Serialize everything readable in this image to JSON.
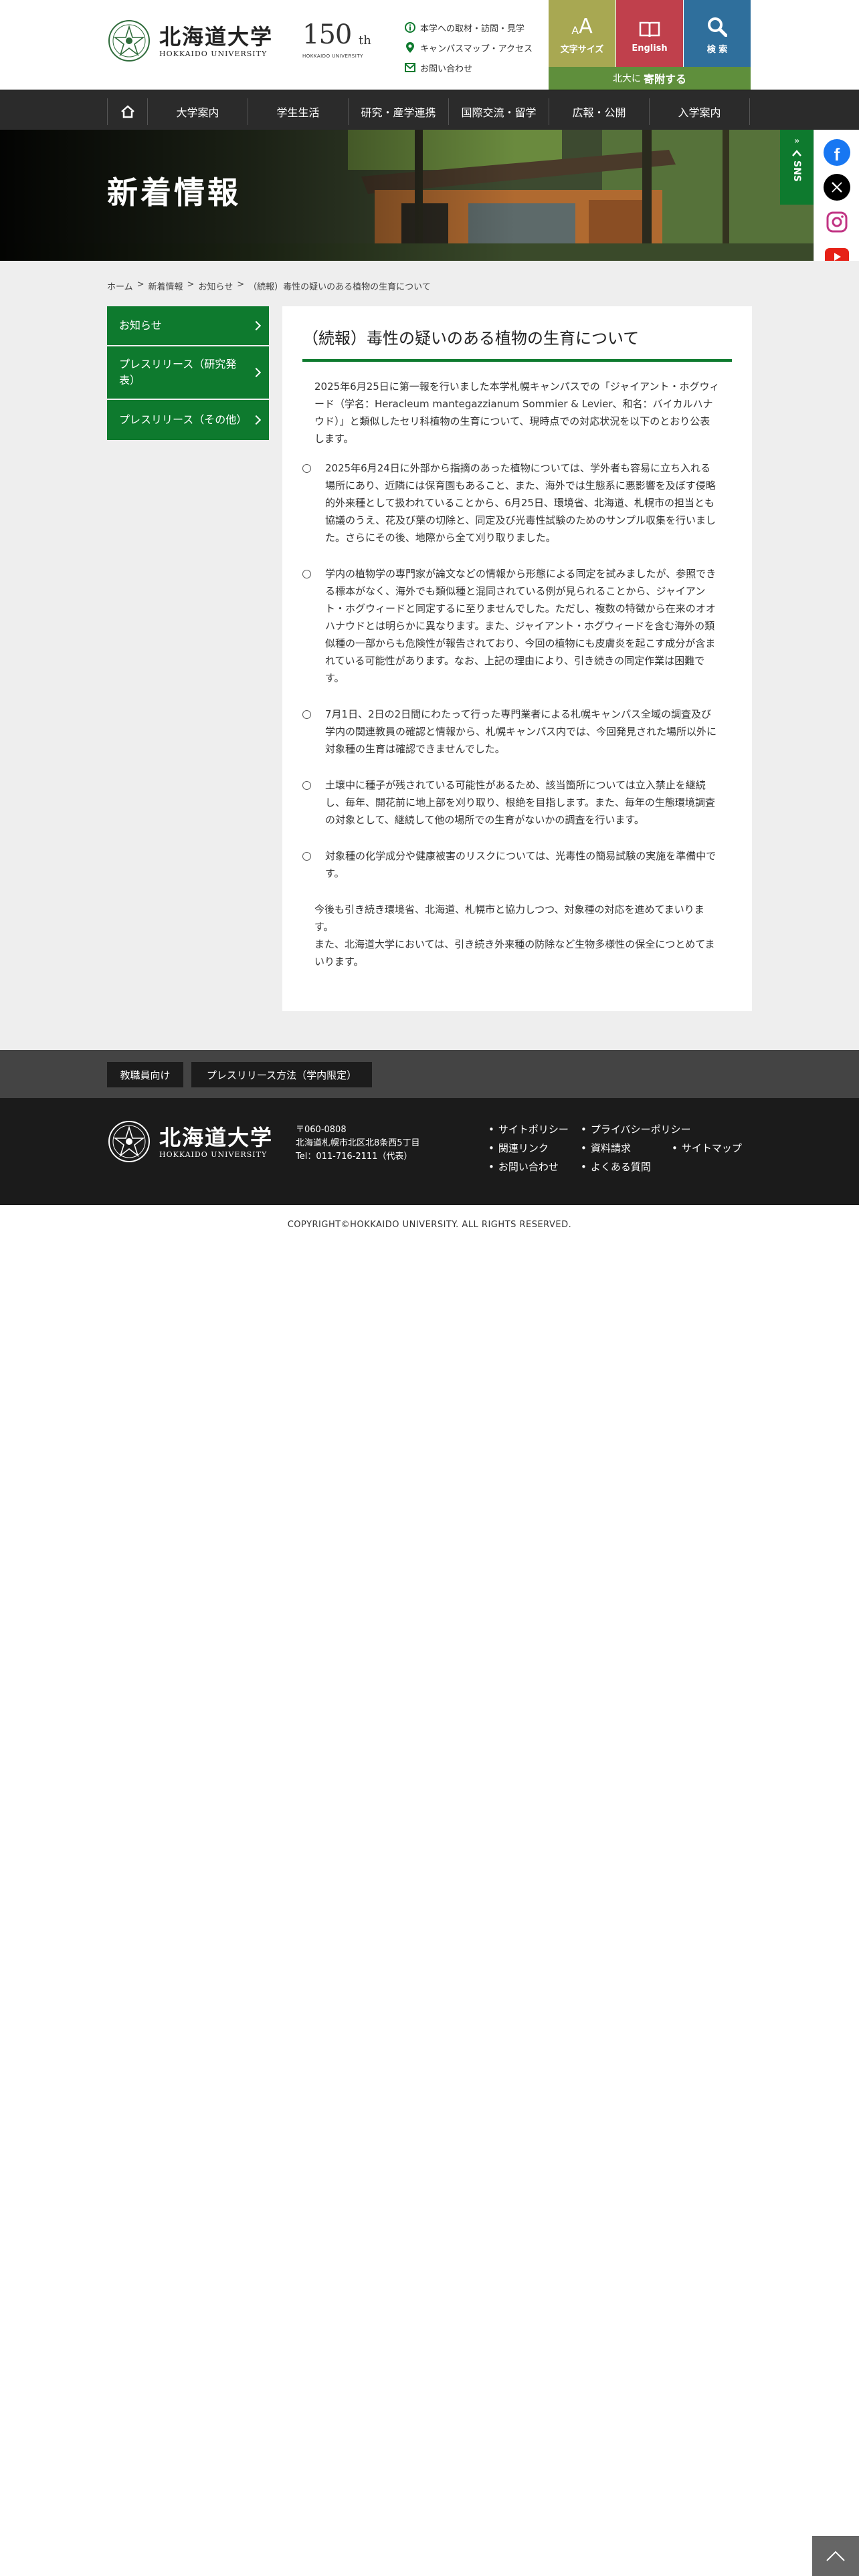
{
  "header": {
    "logo_ja": "北海道大学",
    "logo_en": "HOKKAIDO UNIVERSITY",
    "anniv_number": "150",
    "anniv_suffix": "th",
    "anniv_caption": "HOKKAIDO UNIVERSITY",
    "links": [
      {
        "label": "本学への取材・訪問・見学",
        "icon": "info-circle-icon"
      },
      {
        "label": "キャンパスマップ・アクセス",
        "icon": "map-pin-icon"
      },
      {
        "label": "お問い合わせ",
        "icon": "mail-icon"
      }
    ],
    "font_size_label": "文字サイズ",
    "english_label": "English",
    "search_label": "検 索",
    "donate_prefix": "北大に",
    "donate_strong": "寄附する",
    "colors": {
      "font_size": "#a8a852",
      "english": "#c0404c",
      "search": "#2f6f9c",
      "donate": "#5f8f3c"
    }
  },
  "gnav": {
    "items": [
      "大学案内",
      "学生生活",
      "研究・産学連携",
      "国際交流・留学",
      "広報・公開",
      "入学案内"
    ]
  },
  "hero": {
    "title": "新着情報"
  },
  "sns": {
    "label": "SNS",
    "icons": [
      "facebook-icon",
      "x-twitter-icon",
      "instagram-icon",
      "youtube-icon"
    ]
  },
  "breadcrumb": [
    "ホーム",
    "新着情報",
    "お知らせ",
    "（続報）毒性の疑いのある植物の生育について"
  ],
  "sidenav": {
    "items": [
      "お知らせ",
      "プレスリリース（研究発表）",
      "プレスリリース（その他）"
    ]
  },
  "article": {
    "title": "（続報）毒性の疑いのある植物の生育について",
    "lead": "2025年6月25日に第一報を行いました本学札幌キャンパスでの「ジャイアント・ホグウィード（学名：Heracleum mantegazzianum Sommier & Levier、和名：バイカルハナウド）」と類似したセリ科植物の生育について、現時点での対応状況を以下のとおり公表します。",
    "items": [
      "2025年6月24日に外部から指摘のあった植物については、学外者も容易に立ち入れる場所にあり、近隣には保育園もあること、また、海外では生態系に悪影響を及ぼす侵略的外来種として扱われていることから、6月25日、環境省、北海道、札幌市の担当とも協議のうえ、花及び葉の切除と、同定及び光毒性試験のためのサンプル収集を行いました。さらにその後、地際から全て刈り取りました。",
      "学内の植物学の専門家が論文などの情報から形態による同定を試みましたが、参照できる標本がなく、海外でも類似種と混同されている例が見られることから、ジャイアント・ホグウィードと同定するに至りませんでした。ただし、複数の特徴から在来のオオハナウドとは明らかに異なります。また、ジャイアント・ホグウィードを含む海外の類似種の一部からも危険性が報告されており、今回の植物にも皮膚炎を起こす成分が含まれている可能性があります。なお、上記の理由により、引き続きの同定作業は困難です。",
      "7月1日、2日の2日間にわたって行った専門業者による札幌キャンパス全域の調査及び学内の関連教員の確認と情報から、札幌キャンパス内では、今回発見された場所以外に対象種の生育は確認できませんでした。",
      "土壌中に種子が残されている可能性があるため、該当箇所については立入禁止を継続し、毎年、開花前に地上部を刈り取り、根絶を目指します。また、毎年の生態環境調査の対象として、継続して他の場所での生育がないかの調査を行います。",
      "対象種の化学成分や健康被害のリスクについては、光毒性の簡易試験の実施を準備中です。"
    ],
    "closing": [
      "今後も引き続き環境省、北海道、札幌市と協力しつつ、対象種の対応を進めてまいります。",
      "また、北海道大学においては、引き続き外来種の防除など生物多様性の保全につとめてまいります。"
    ],
    "accent_color": "#0e7a2e"
  },
  "footer": {
    "buttons": [
      "教職員向け",
      "プレスリリース方法（学内限定）"
    ],
    "logo_ja": "北海道大学",
    "logo_en": "HOKKAIDO UNIVERSITY",
    "address": [
      "〒060-0808",
      "北海道札幌市北区北8条西5丁目",
      "Tel：011-716-2111（代表）"
    ],
    "links": [
      "サイトポリシー",
      "プライバシーポリシー",
      "関連リンク",
      "資料請求",
      "サイトマップ",
      "お問い合わせ",
      "よくある質問"
    ],
    "copyright": "COPYRIGHT©HOKKAIDO UNIVERSITY. ALL RIGHTS RESERVED."
  }
}
